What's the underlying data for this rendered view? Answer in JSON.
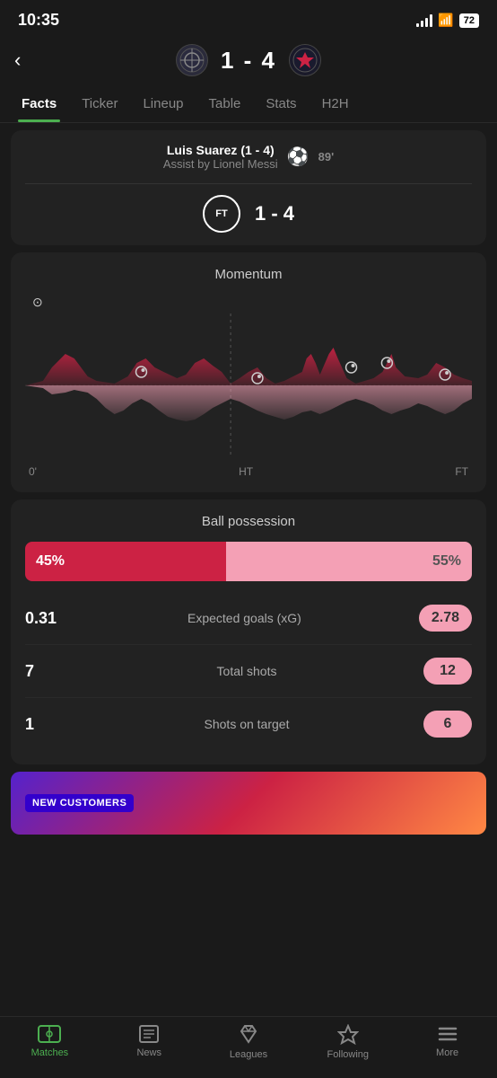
{
  "statusBar": {
    "time": "10:35",
    "battery": "72"
  },
  "header": {
    "backLabel": "‹",
    "homeTeamInitial": "⊕",
    "scoreText": "1  -  4",
    "awayTeamInitial": "⊕"
  },
  "tabs": [
    {
      "label": "Facts",
      "active": true
    },
    {
      "label": "Ticker",
      "active": false
    },
    {
      "label": "Lineup",
      "active": false
    },
    {
      "label": "Table",
      "active": false
    },
    {
      "label": "Stats",
      "active": false
    },
    {
      "label": "H2H",
      "active": false
    }
  ],
  "lastEvent": {
    "scorer": "Luis Suarez (1 - 4)",
    "assist": "Assist by Lionel Messi",
    "time": "89'",
    "ftLabel": "FT",
    "ftScore": "1 - 4"
  },
  "momentum": {
    "title": "Momentum",
    "xAxisLabels": [
      "0'",
      "HT",
      "FT"
    ]
  },
  "possession": {
    "title": "Ball possession",
    "homePercent": 45,
    "awayPercent": 55,
    "homeLabel": "45%",
    "awayLabel": "55%"
  },
  "stats": [
    {
      "leftVal": "0.31",
      "label": "Expected goals (xG)",
      "rightVal": "2.78"
    },
    {
      "leftVal": "7",
      "label": "Total shots",
      "rightVal": "12"
    },
    {
      "leftVal": "1",
      "label": "Shots on target",
      "rightVal": "6"
    }
  ],
  "adBanner": {
    "label": "NEW CUSTOMERS"
  },
  "bottomNav": [
    {
      "label": "Matches",
      "active": true,
      "iconType": "matches"
    },
    {
      "label": "News",
      "active": false,
      "iconType": "news"
    },
    {
      "label": "Leagues",
      "active": false,
      "iconType": "leagues"
    },
    {
      "label": "Following",
      "active": false,
      "iconType": "following"
    },
    {
      "label": "More",
      "active": false,
      "iconType": "more"
    }
  ]
}
